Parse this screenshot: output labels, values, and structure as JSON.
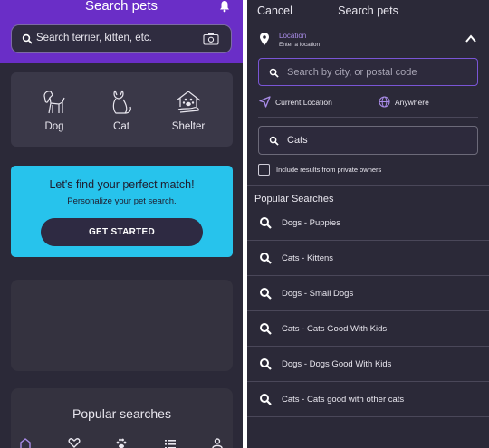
{
  "left": {
    "header_title": "Search pets",
    "search_placeholder": "Search terrier, kitten, etc.",
    "categories": [
      {
        "label": "Dog",
        "icon": "dog-icon"
      },
      {
        "label": "Cat",
        "icon": "cat-icon"
      },
      {
        "label": "Shelter",
        "icon": "shelter-icon"
      }
    ],
    "match_card": {
      "title": "Let's find your perfect match!",
      "subtitle": "Personalize your pet search.",
      "button_label": "GET STARTED"
    },
    "popular_title": "Popular searches",
    "tabs": [
      "home-icon",
      "heart-icon",
      "paw-icon",
      "list-icon",
      "person-icon"
    ]
  },
  "right": {
    "cancel_label": "Cancel",
    "title": "Search pets",
    "location_label": "Location",
    "location_hint": "Enter a location",
    "city_placeholder": "Search by city, or postal code",
    "current_location_label": "Current Location",
    "anywhere_label": "Anywhere",
    "search_value": "Cats",
    "private_owners_label": "Include results from private owners",
    "popular_heading": "Popular Searches",
    "popular_items": [
      "Dogs - Puppies",
      "Cats - Kittens",
      "Dogs - Small Dogs",
      "Cats - Cats Good With Kids",
      "Dogs - Dogs Good With Kids",
      "Cats - Cats good with other cats"
    ]
  },
  "colors": {
    "header_purple": "#6a2ec7",
    "background": "#2b2938",
    "card": "#3a3848",
    "accent_cyan": "#27c3ec",
    "accent_violet": "#a98ce8"
  }
}
